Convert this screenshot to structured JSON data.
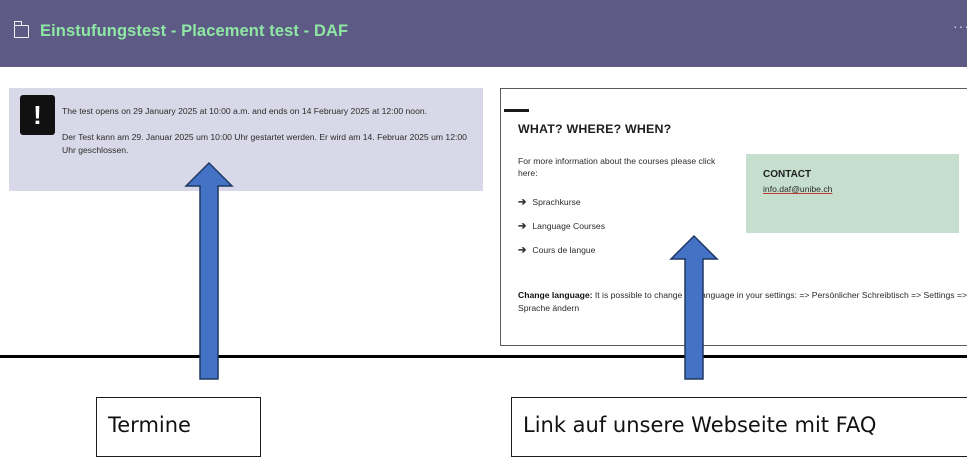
{
  "header": {
    "title": "Einstufungstest - Placement test - DAF",
    "more_glyph": "···"
  },
  "notice": {
    "icon_glyph": "!",
    "english_text": "The test opens on 29 January 2025 at 10:00 a.m. and ends on 14 February 2025 at 12:00 noon.",
    "german_text": "Der Test kann am 29. Januar 2025 um 10:00 Uhr gestartet werden. Er wird am 14. Februar 2025 um 12:00 Uhr geschlossen."
  },
  "info": {
    "heading": "WHAT? WHERE? WHEN?",
    "intro": "For more information about the courses please click here:",
    "arrow_glyph": "➔",
    "links": [
      {
        "label": "Sprachkurse"
      },
      {
        "label": "Language Courses"
      },
      {
        "label": "Cours de langue"
      }
    ],
    "change_label": "Change language:",
    "change_text": " It is possible to change the language in your settings: => Persönlicher Schreibtisch => Settings => Sprache ändern"
  },
  "contact": {
    "title": "CONTACT",
    "email": "info.daf@unibe.ch"
  },
  "annotations": {
    "left_caption": "Termine",
    "right_caption": "Link auf unsere Webseite mit FAQ",
    "arrow_color": "#4472c4",
    "arrow_outline": "#1f3864"
  }
}
